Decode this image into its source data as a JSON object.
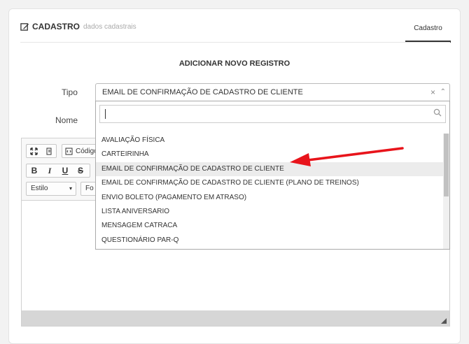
{
  "header": {
    "title": "CADASTRO",
    "subtitle": "dados cadastrais",
    "tab": "Cadastro"
  },
  "form": {
    "title": "ADICIONAR NOVO REGISTRO",
    "tipo_label": "Tipo",
    "nome_label": "Nome",
    "tipo_value": "EMAIL DE CONFIRMAÇÃO DE CADASTRO DE CLIENTE",
    "clear_glyph": "×",
    "arrow_glyph": "⌃"
  },
  "editor": {
    "code_label": "Código",
    "estilo_label": "Estilo",
    "fonte_label": "Fo",
    "bold": "B",
    "italic": "I",
    "underline": "U",
    "strike": "S"
  },
  "dropdown": {
    "search_value": "",
    "items": [
      "AVALIAÇÃO FÍSICA",
      "CARTEIRINHA",
      "EMAIL DE CONFIRMAÇÃO DE CADASTRO DE CLIENTE",
      "EMAIL DE CONFIRMAÇÃO DE CADASTRO DE CLIENTE (PLANO DE TREINOS)",
      "ENVIO BOLETO (PAGAMENTO EM ATRASO)",
      "LISTA ANIVERSARIO",
      "MENSAGEM CATRACA",
      "QUESTIONÁRIO PAR-Q"
    ],
    "hovered_index": 2
  },
  "colors": {
    "annotation_arrow": "#e8141b",
    "hover_bg": "#ececec"
  }
}
